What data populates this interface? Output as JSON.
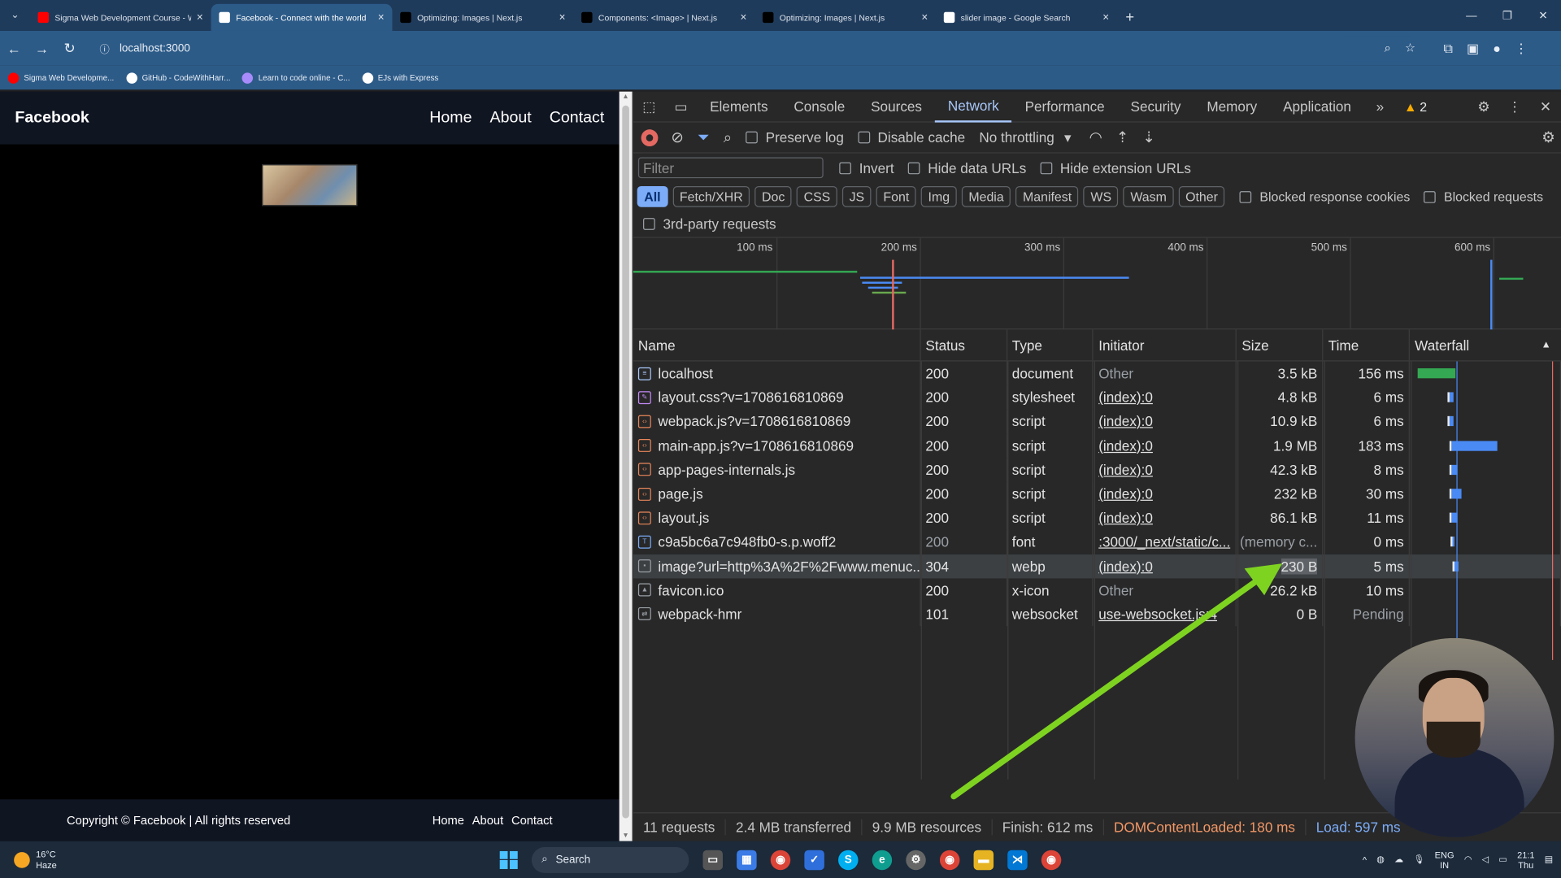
{
  "browser": {
    "tabs": [
      {
        "title": "Sigma Web Development Course - W",
        "favicon": "youtube-icon",
        "color": "#ff0000"
      },
      {
        "title": "Facebook - Connect with the world",
        "favicon": "vercel-icon",
        "color": "#ffffff",
        "active": true
      },
      {
        "title": "Optimizing: Images | Next.js",
        "favicon": "nextjs-icon",
        "color": "#000000"
      },
      {
        "title": "Components: <Image> | Next.js",
        "favicon": "nextjs-icon",
        "color": "#000000"
      },
      {
        "title": "Optimizing: Images | Next.js",
        "favicon": "nextjs-icon",
        "color": "#000000"
      },
      {
        "title": "slider image - Google Search",
        "favicon": "google-icon",
        "color": "#ffffff"
      }
    ],
    "url": "localhost:3000",
    "bookmarks": [
      {
        "label": "Sigma Web Developme...",
        "color": "#ff0000"
      },
      {
        "label": "GitHub - CodeWithHarr...",
        "color": "#ffffff"
      },
      {
        "label": "Learn to code online - C...",
        "color": "#a78bfa"
      },
      {
        "label": "EJs with Express",
        "color": "#ffffff"
      }
    ]
  },
  "site": {
    "brand": "Facebook",
    "nav": [
      "Home",
      "About",
      "Contact"
    ],
    "footer_copy": "Copyright © Facebook | All rights reserved",
    "footer_links": [
      "Home",
      "About",
      "Contact"
    ]
  },
  "devtools": {
    "tabs": [
      "Elements",
      "Console",
      "Sources",
      "Network",
      "Performance",
      "Security",
      "Memory",
      "Application"
    ],
    "active_tab": "Network",
    "warnings": "2",
    "toolbar": {
      "preserve_log": "Preserve log",
      "disable_cache": "Disable cache",
      "throttling": "No throttling"
    },
    "filter": {
      "placeholder": "Filter",
      "invert": "Invert",
      "hide_data_urls": "Hide data URLs",
      "hide_extension_urls": "Hide extension URLs"
    },
    "chips": [
      "All",
      "Fetch/XHR",
      "Doc",
      "CSS",
      "JS",
      "Font",
      "Img",
      "Media",
      "Manifest",
      "WS",
      "Wasm",
      "Other"
    ],
    "blocked_cookies": "Blocked response cookies",
    "blocked_requests": "Blocked requests",
    "third_party": "3rd-party requests",
    "ticks": [
      "100 ms",
      "200 ms",
      "300 ms",
      "400 ms",
      "500 ms",
      "600 ms"
    ],
    "columns": [
      "Name",
      "Status",
      "Type",
      "Initiator",
      "Size",
      "Time",
      "Waterfall"
    ],
    "rows": [
      {
        "name": "localhost",
        "status": "200",
        "type": "document",
        "initiator": "Other",
        "size": "3.5 kB",
        "time": "156 ms",
        "icon": "doc"
      },
      {
        "name": "layout.css?v=1708616810869",
        "status": "200",
        "type": "stylesheet",
        "initiator": "(index):0",
        "size": "4.8 kB",
        "time": "6 ms",
        "icon": "css"
      },
      {
        "name": "webpack.js?v=1708616810869",
        "status": "200",
        "type": "script",
        "initiator": "(index):0",
        "size": "10.9 kB",
        "time": "6 ms",
        "icon": "js"
      },
      {
        "name": "main-app.js?v=1708616810869",
        "status": "200",
        "type": "script",
        "initiator": "(index):0",
        "size": "1.9 MB",
        "time": "183 ms",
        "icon": "js"
      },
      {
        "name": "app-pages-internals.js",
        "status": "200",
        "type": "script",
        "initiator": "(index):0",
        "size": "42.3 kB",
        "time": "8 ms",
        "icon": "js"
      },
      {
        "name": "page.js",
        "status": "200",
        "type": "script",
        "initiator": "(index):0",
        "size": "232 kB",
        "time": "30 ms",
        "icon": "js"
      },
      {
        "name": "layout.js",
        "status": "200",
        "type": "script",
        "initiator": "(index):0",
        "size": "86.1 kB",
        "time": "11 ms",
        "icon": "js"
      },
      {
        "name": "c9a5bc6a7c948fb0-s.p.woff2",
        "status": "200",
        "type": "font",
        "initiator": ":3000/_next/static/c...",
        "size": "(memory c...",
        "time": "0 ms",
        "icon": "font"
      },
      {
        "name": "image?url=http%3A%2F%2Fwww.menuc...",
        "status": "304",
        "type": "webp",
        "initiator": "(index):0",
        "size": "230 B",
        "time": "5 ms",
        "icon": "img"
      },
      {
        "name": "favicon.ico",
        "status": "200",
        "type": "x-icon",
        "initiator": "Other",
        "size": "26.2 kB",
        "time": "10 ms",
        "icon": "ico"
      },
      {
        "name": "webpack-hmr",
        "status": "101",
        "type": "websocket",
        "initiator": "use-websocket.js:4",
        "size": "0 B",
        "time": "Pending",
        "icon": "ws"
      }
    ],
    "summary": {
      "requests": "11 requests",
      "transferred": "2.4 MB transferred",
      "resources": "9.9 MB resources",
      "finish": "Finish: 612 ms",
      "dcl": "DOMContentLoaded: 180 ms",
      "load": "Load: 597 ms"
    }
  },
  "taskbar": {
    "temp": "16°C",
    "weather": "Haze",
    "search": "Search",
    "lang1": "ENG",
    "lang2": "IN",
    "time": "21:1",
    "day": "Thu"
  },
  "colors": {
    "accent": "#a8c7fa",
    "arrow": "#7ed321",
    "record": "#e46962"
  }
}
